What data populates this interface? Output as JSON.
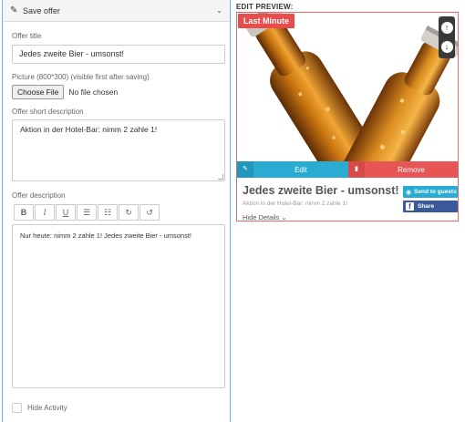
{
  "panel": {
    "header_icon": "edit-icon",
    "header_title": "Save offer",
    "collapse_icon": "chevron-down-icon"
  },
  "form": {
    "offer_title_label": "Offer title",
    "offer_title_value": "Jedes zweite Bier - umsonst!",
    "picture_label": "Picture (800*300) (visible first after saving)",
    "choose_file_label": "Choose File",
    "no_file_label": "No file chosen",
    "short_desc_label": "Offer short description",
    "short_desc_value": "Aktion in der Hotel-Bar: nimm 2 zahle 1!",
    "desc_label": "Offer description",
    "desc_value": "Nur heute: nimm 2 zahle 1! Jedes zweite Bier - umsonst!",
    "toolbar": [
      "B",
      "I",
      "U",
      "☰",
      "☷",
      "↻",
      "↺"
    ],
    "hide_activity_label": "Hide Activity",
    "hide_activity_checked": false
  },
  "preview": {
    "heading": "EDIT PREVIEW:",
    "badge": "Last Minute",
    "edit_label": "Edit",
    "remove_label": "Remove",
    "title": "Jedes zweite Bier - umsonst!",
    "subtitle": "Aktion in der Hotel-Bar: nimm 2 zahle 1!",
    "hide_details": "Hide Details ⌄",
    "send_label": "Send to guests",
    "share_label": "Share",
    "colors": {
      "badge": "#e84c4c",
      "edit": "#2aabd2",
      "remove": "#e85555",
      "facebook": "#3b5998"
    }
  }
}
